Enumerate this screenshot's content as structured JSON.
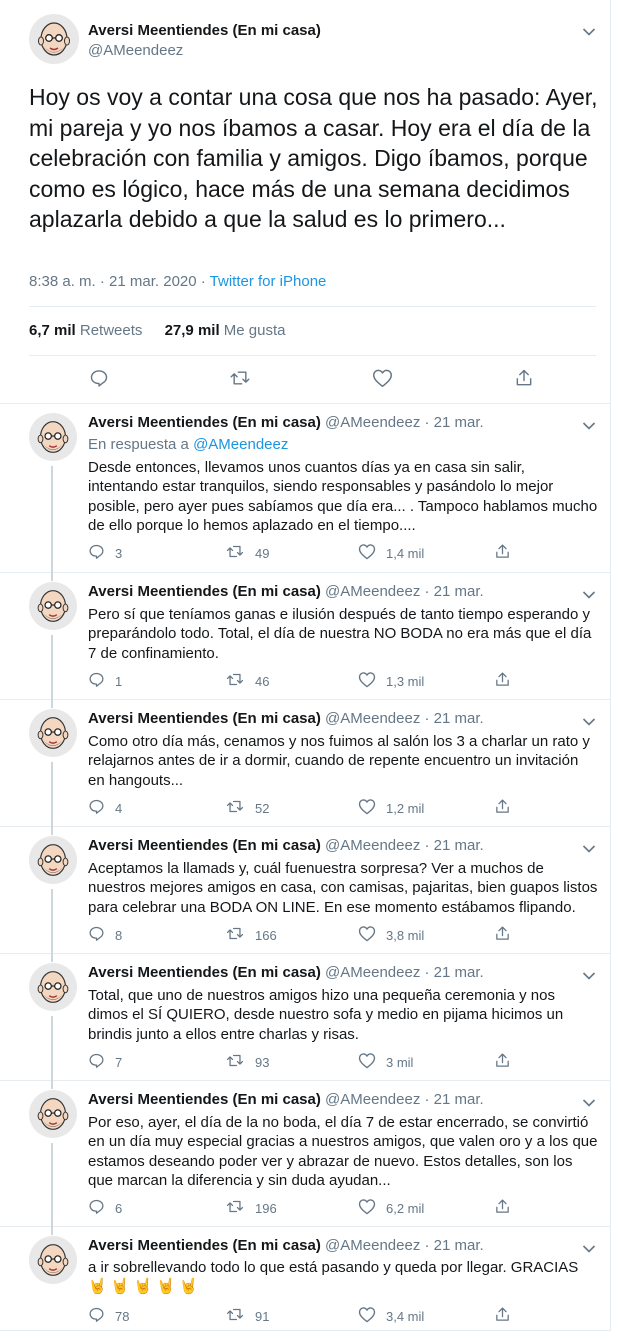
{
  "main": {
    "name": "Aversi Meentiendes (En mi casa)",
    "handle": "@AMeendeez",
    "text": "Hoy os voy a contar una cosa que nos ha pasado: Ayer, mi pareja y yo nos íbamos a casar. Hoy era el día de la celebración con familia y amigos. Digo íbamos, porque como es lógico, hace más de una semana decidimos aplazarla debido a que la salud es lo primero...",
    "time": "8:38 a. m. · 21 mar. 2020 · ",
    "source": "Twitter for iPhone",
    "retweets_count": "6,7 mil",
    "retweets_label": "Retweets",
    "likes_count": "27,9 mil",
    "likes_label": "Me gusta"
  },
  "replies": [
    {
      "name": "Aversi Meentiendes (En mi casa)",
      "meta": " @AMeendeez · 21 mar.",
      "reply_prefix": "En respuesta a ",
      "reply_to": "@AMeendeez",
      "text": "Desde entonces, llevamos unos cuantos días ya en casa sin salir, intentando estar tranquilos, siendo responsables y pasándolo lo mejor posible, pero ayer pues sabíamos que día era... . Tampoco hablamos mucho de ello porque lo hemos aplazado en el tiempo....",
      "replies": "3",
      "retweets": "49",
      "likes": "1,4 mil"
    },
    {
      "name": "Aversi Meentiendes (En mi casa)",
      "meta": " @AMeendeez · 21 mar.",
      "text": "Pero sí que teníamos ganas e ilusión después de tanto tiempo esperando y preparándolo todo. Total, el día de nuestra NO BODA no era más que el día 7 de confinamiento.",
      "replies": "1",
      "retweets": "46",
      "likes": "1,3 mil"
    },
    {
      "name": "Aversi Meentiendes (En mi casa)",
      "meta": " @AMeendeez · 21 mar.",
      "text": "Como otro día más, cenamos y nos fuimos al salón los 3 a charlar un rato y relajarnos antes de ir a dormir, cuando de repente encuentro un invitación en hangouts...",
      "replies": "4",
      "retweets": "52",
      "likes": "1,2 mil"
    },
    {
      "name": "Aversi Meentiendes (En mi casa)",
      "meta": " @AMeendeez · 21 mar.",
      "text": "Aceptamos la llamads y, cuál fuenuestra sorpresa? Ver a muchos de nuestros mejores amigos en casa, con camisas, pajaritas, bien guapos listos para celebrar una BODA ON LINE. En ese momento estábamos flipando.",
      "replies": "8",
      "retweets": "166",
      "likes": "3,8 mil"
    },
    {
      "name": "Aversi Meentiendes (En mi casa)",
      "meta": " @AMeendeez · 21 mar.",
      "text": "Total, que uno de nuestros amigos hizo una pequeña ceremonia y nos dimos el SÍ QUIERO, desde nuestro sofa y medio en pijama hicimos un brindis junto a ellos entre charlas y risas.",
      "replies": "7",
      "retweets": "93",
      "likes": "3 mil"
    },
    {
      "name": "Aversi Meentiendes (En mi casa)",
      "meta": " @AMeendeez · 21 mar.",
      "text": "Por eso, ayer, el día de la no boda, el día 7 de estar encerrado, se convirtió en un día muy especial gracias a nuestros amigos, que valen oro y a los que estamos deseando poder ver y abrazar de nuevo. Estos detalles, son los que marcan la diferencia y sin duda ayudan...",
      "replies": "6",
      "retweets": "196",
      "likes": "6,2 mil"
    },
    {
      "name": "Aversi Meentiendes (En mi casa)",
      "meta": " @AMeendeez · 21 mar.",
      "text": "a ir sobrellevando todo lo que está pasando y queda por llegar. GRACIAS 🤘 🤘 🤘 🤘 🤘",
      "replies": "78",
      "retweets": "91",
      "likes": "3,4 mil"
    }
  ],
  "icons": {
    "avatar": "bald-cartoon-man-avatar",
    "reply": "reply-icon",
    "retweet": "retweet-icon",
    "like": "heart-icon",
    "share": "share-icon",
    "menu": "chevron-down-icon"
  },
  "colors": {
    "text": "#14171a",
    "secondary": "#657786",
    "link": "#1b95e0",
    "border": "#e6ecf0",
    "thread_line": "#ccd6dd"
  }
}
